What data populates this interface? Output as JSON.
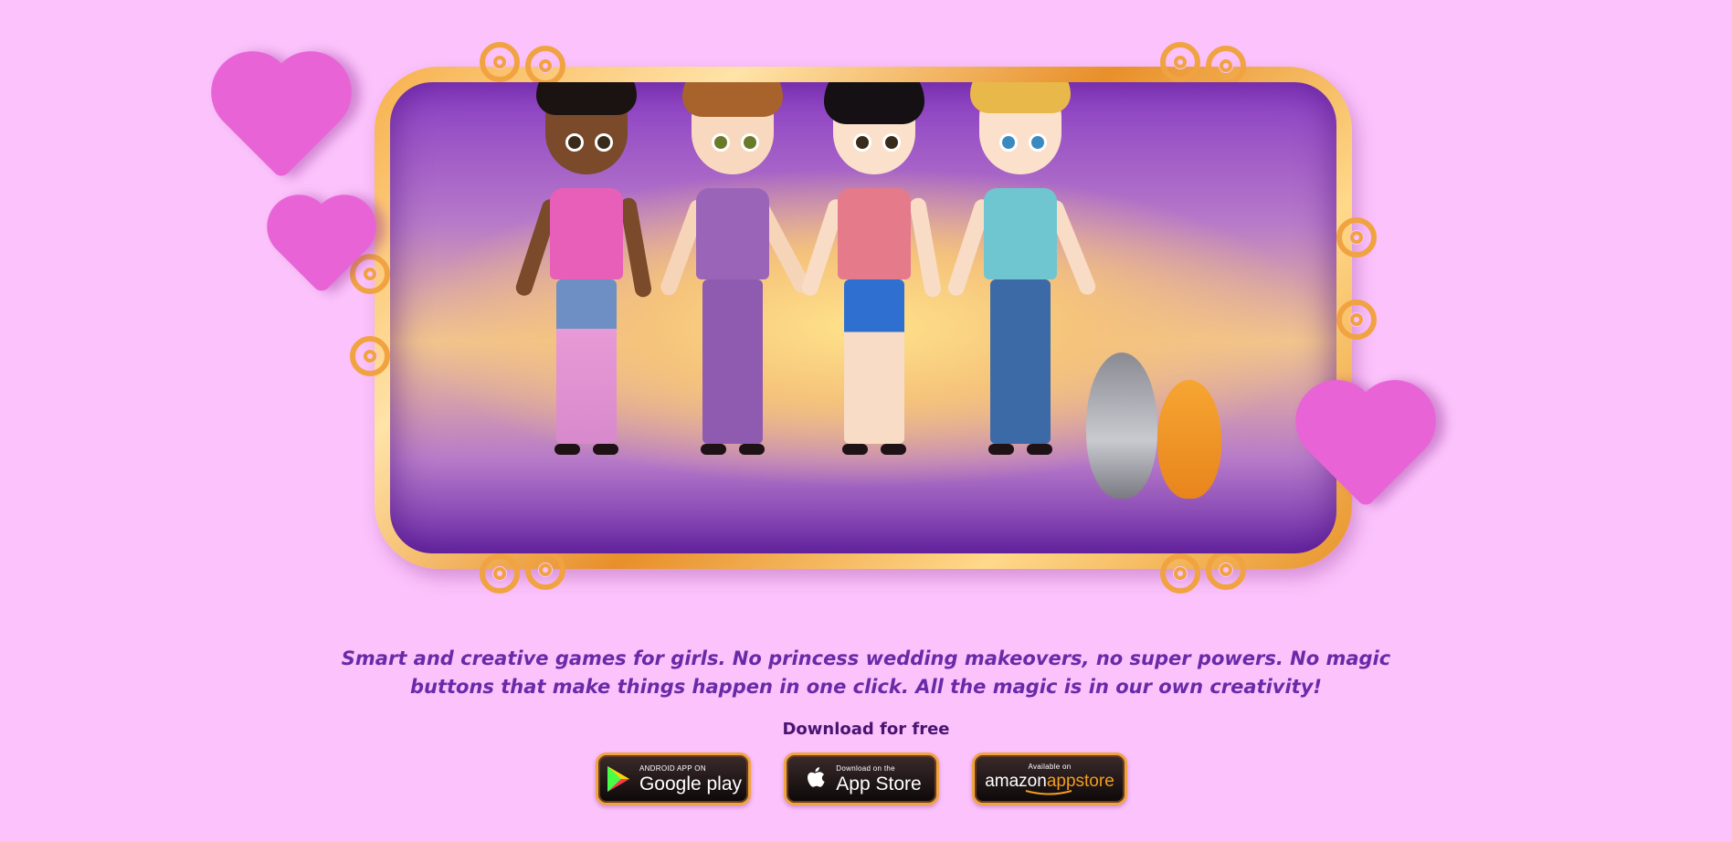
{
  "hero": {
    "characters": [
      "girl-1",
      "girl-2",
      "girl-3",
      "girl-4"
    ],
    "pets": [
      "dog",
      "cat"
    ]
  },
  "tagline": "Smart and creative games for girls. No princess wedding makeovers, no super powers. No magic buttons that make things happen in one click. All the magic is in our own creativity!",
  "download": {
    "label": "Download for free",
    "stores": [
      {
        "name": "google-play",
        "small": "ANDROID APP ON",
        "big": "Google play",
        "icon": "google-play-icon"
      },
      {
        "name": "app-store",
        "small": "Download on the",
        "big": "App Store",
        "icon": "apple-icon"
      },
      {
        "name": "amazon",
        "small": "Available on",
        "big_a": "amazon",
        "big_b": "appstore",
        "icon": "amazon-smile-icon"
      }
    ]
  },
  "colors": {
    "background": "#fbc2fb",
    "text_purple": "#6a2aa8",
    "frame_gold": "#f0a340",
    "heart_pink": "#e864d6"
  }
}
